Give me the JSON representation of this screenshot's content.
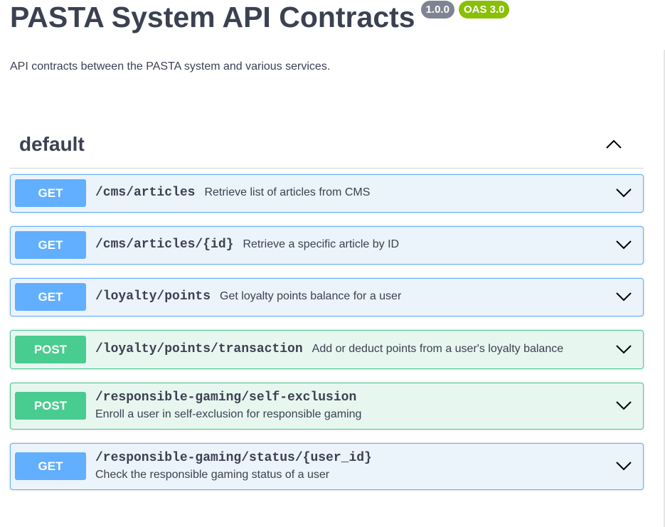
{
  "info": {
    "title": "PASTA System API Contracts",
    "version": "1.0.0",
    "oas_version": "OAS 3.0",
    "description": "API contracts between the PASTA system and various services."
  },
  "tag": {
    "name": "default",
    "expanded": true
  },
  "operations": [
    {
      "method": "GET",
      "path": "/cms/articles",
      "summary": "Retrieve list of articles from CMS"
    },
    {
      "method": "GET",
      "path": "/cms/articles/{id}",
      "summary": "Retrieve a specific article by ID"
    },
    {
      "method": "GET",
      "path": "/loyalty/points",
      "summary": "Get loyalty points balance for a user"
    },
    {
      "method": "POST",
      "path": "/loyalty/points/transaction",
      "summary": "Add or deduct points from a user's loyalty balance"
    },
    {
      "method": "POST",
      "path": "/responsible-gaming/self-exclusion",
      "summary": "Enroll a user in self-exclusion for responsible gaming"
    },
    {
      "method": "GET",
      "path": "/responsible-gaming/status/{user_id}",
      "summary": "Check the responsible gaming status of a user"
    }
  ],
  "colors": {
    "get": "#61affe",
    "post": "#49cc90",
    "text": "#3b4151",
    "version_badge": "#7d8492",
    "oas_badge": "#89bf04"
  },
  "icons": {
    "tag_toggle": "chevron-up-icon",
    "operation_toggle": "chevron-down-icon"
  }
}
